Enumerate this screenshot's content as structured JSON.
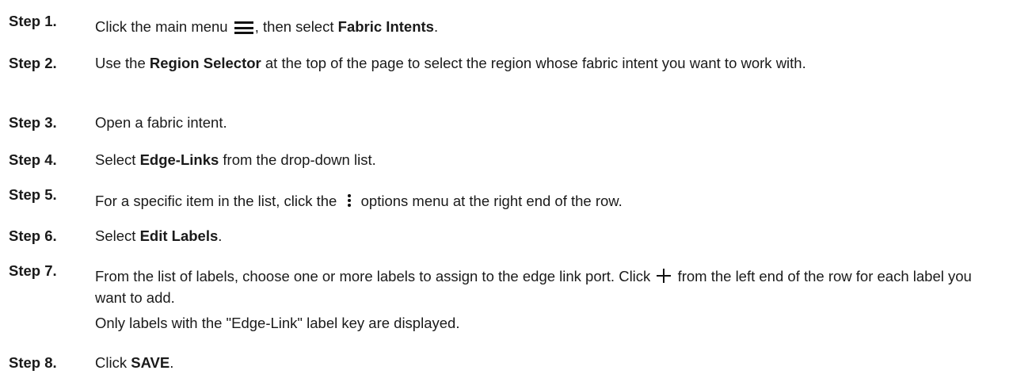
{
  "steps": [
    {
      "label": "Step 1.",
      "pre": "Click the main menu ",
      "icon": "menu-icon",
      "mid": ", then select ",
      "bold": "Fabric Intents",
      "post": "."
    },
    {
      "label": "Step 2.",
      "pre": "Use the ",
      "bold": "Region Selector",
      "post": " at the top of the page to select the region whose fabric intent you want to work with."
    },
    {
      "label": "Step 3.",
      "text": "Open a fabric intent."
    },
    {
      "label": "Step 4.",
      "pre": "Select ",
      "bold": "Edge-Links",
      "post": " from the drop-down list."
    },
    {
      "label": "Step 5.",
      "pre": "For a specific item in the list, click the ",
      "icon": "more-vertical-icon",
      "post": " options menu at the right end of the row."
    },
    {
      "label": "Step 6.",
      "pre": "Select ",
      "bold": "Edit Labels",
      "post": "."
    },
    {
      "label": "Step 7.",
      "pre": "From the list of labels, choose one or more labels to assign to the edge link port. Click ",
      "icon": "plus-icon",
      "post": " from the left end of the row for each label you want to add.",
      "note": "Only labels with the \"Edge-Link\" label key are displayed."
    },
    {
      "label": "Step 8.",
      "pre": "Click ",
      "bold": "SAVE",
      "post": "."
    }
  ]
}
